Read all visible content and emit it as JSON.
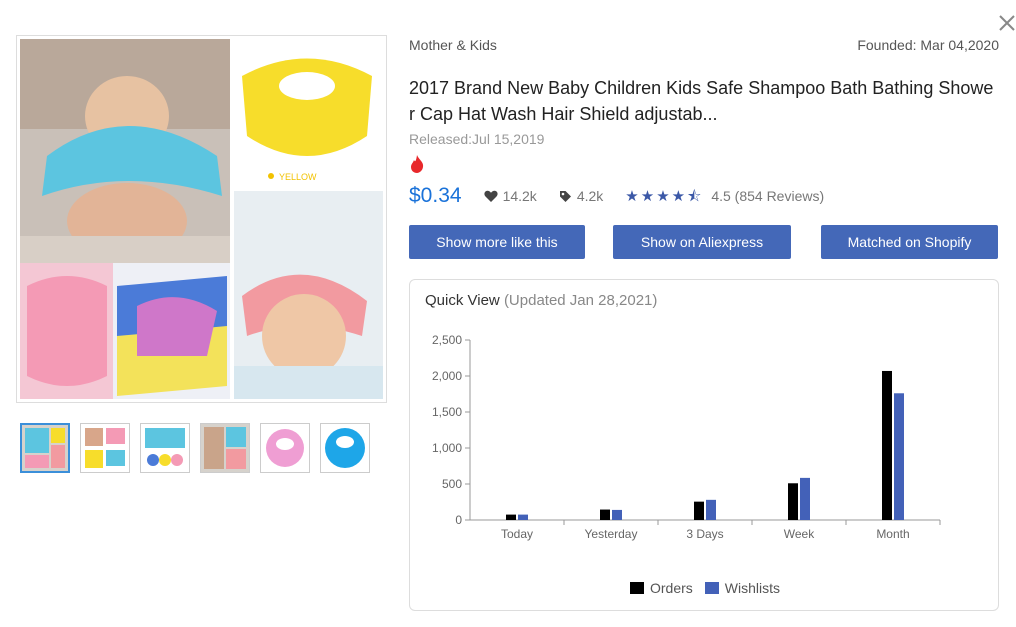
{
  "product": {
    "category": "Mother & Kids",
    "founded": "Founded: Mar 04,2020",
    "title": "2017 Brand New Baby Children Kids Safe Shampoo Bath Bathing Shower Cap Hat Wash Hair Shield adjustab...",
    "released": "Released:Jul 15,2019",
    "price": "$0.34",
    "likes": "14.2k",
    "tags": "4.2k",
    "rating_text": "4.5 (854 Reviews)",
    "rating": 4.5,
    "image_tag": "YELLOW"
  },
  "buttons": {
    "more_like": "Show more like this",
    "aliexpress": "Show on Aliexpress",
    "shopify": "Matched on Shopify"
  },
  "quick_view": {
    "title": "Quick View",
    "updated": "(Updated Jan 28,2021)"
  },
  "colors": {
    "accent": "#4468b8",
    "price": "#1a72d9",
    "orders": "#000000",
    "wishlists": "#4361b8"
  },
  "chart_data": {
    "type": "bar",
    "categories": [
      "Today",
      "Yesterday",
      "3 Days",
      "Week",
      "Month"
    ],
    "series": [
      {
        "name": "Orders",
        "values": [
          75,
          145,
          255,
          510,
          2070
        ]
      },
      {
        "name": "Wishlists",
        "values": [
          75,
          140,
          280,
          585,
          1760
        ]
      }
    ],
    "y_ticks": [
      "0",
      "500",
      "1,000",
      "1,500",
      "2,000",
      "2,500"
    ],
    "ylim": [
      0,
      2500
    ]
  }
}
